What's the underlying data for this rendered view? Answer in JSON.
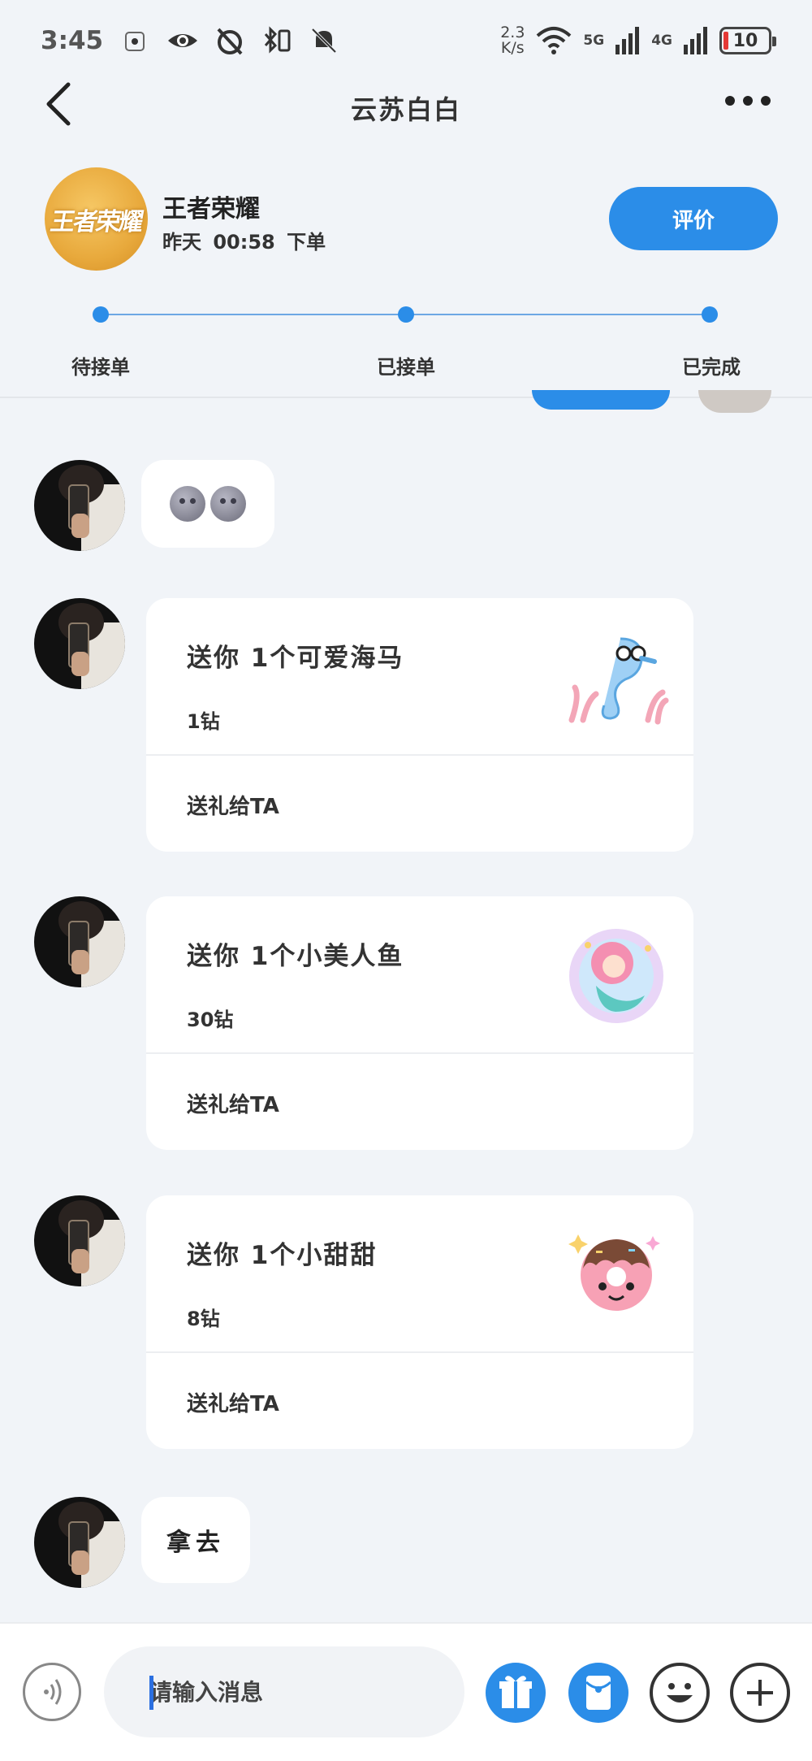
{
  "status_bar": {
    "time": "3:45",
    "net_speed_value": "2.3",
    "net_speed_unit": "K/s",
    "signal_1_label": "5G",
    "signal_2_label": "4G",
    "battery": "10"
  },
  "nav": {
    "title": "云苏白白",
    "icons": [
      "back-icon",
      "more-icon"
    ]
  },
  "order": {
    "game_name": "王者荣耀",
    "logo_text": "王者荣耀",
    "order_time": "昨天 00:58 下单",
    "rate_button": "评价",
    "progress_steps": [
      "待接单",
      "已接单",
      "已完成"
    ],
    "progress_current": 3,
    "accent_color": "#2b8de8"
  },
  "messages": [
    {
      "type": "emoji",
      "content": "🌚🌚"
    },
    {
      "type": "gift",
      "title": "送你 1个可爱海马",
      "price": "1钻",
      "action": "送礼给TA",
      "image": "seahorse-sticker"
    },
    {
      "type": "gift",
      "title": "送你 1个小美人鱼",
      "price": "30钻",
      "action": "送礼给TA",
      "image": "mermaid-sticker"
    },
    {
      "type": "gift",
      "title": "送你 1个小甜甜",
      "price": "8钻",
      "action": "送礼给TA",
      "image": "donut-sticker"
    },
    {
      "type": "text",
      "content": "拿去"
    }
  ],
  "input_bar": {
    "placeholder": "请输入消息",
    "icons": [
      "voice-icon",
      "gift-icon",
      "red-packet-icon",
      "emoji-icon",
      "plus-icon"
    ]
  }
}
